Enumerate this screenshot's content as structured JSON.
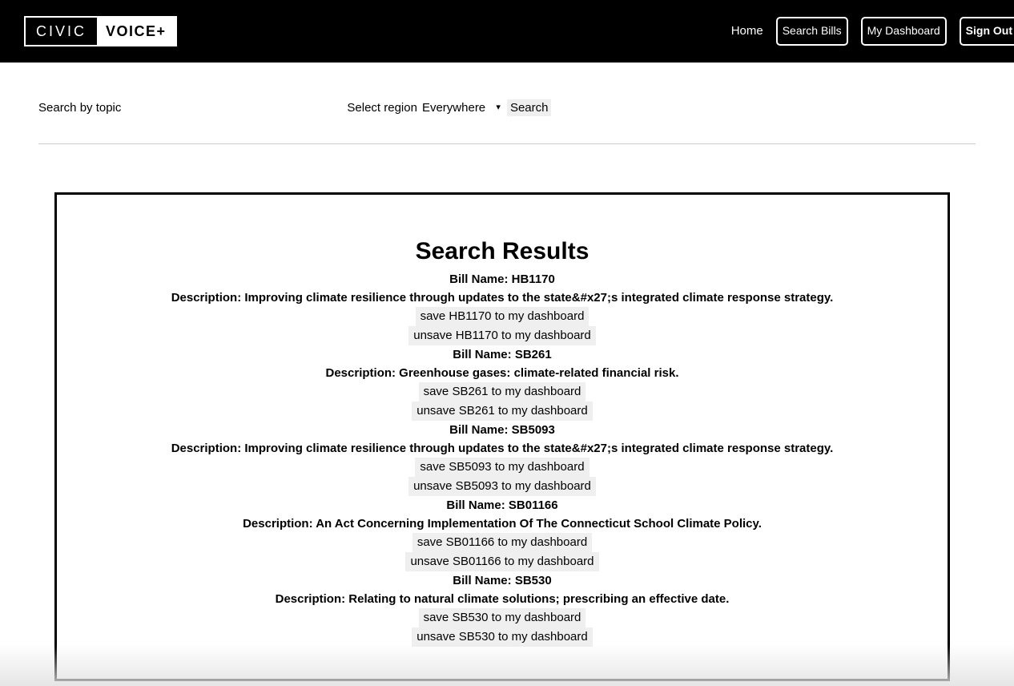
{
  "header": {
    "logo": {
      "left_text": "CIVIC",
      "right_text": "VOICE+"
    },
    "nav": {
      "home_label": "Home",
      "search_bills_label": "Search Bills",
      "my_dashboard_label": "My Dashboard",
      "sign_out_label": "Sign Out"
    },
    "background_color": "#000000",
    "text_color": "#ffffff"
  },
  "searchbar": {
    "topic_label": "Search by topic",
    "topic_value": "",
    "topic_placeholder": "",
    "region_label": "Select region",
    "region_selected": "Everywhere",
    "region_options": [
      "Everywhere"
    ],
    "dropdown_icon": "chevron-down-icon",
    "search_button_label": "Search",
    "button_background": "#efefef"
  },
  "results": {
    "title": "Search Results",
    "bills": [
      {
        "name": "Bill Name: HB1170",
        "description": "Description: Improving climate resilience through updates to the state&#x27;s integrated climate response strategy.",
        "save_label": "save HB1170 to my dashboard",
        "unsave_label": "unsave HB1170 to my dashboard"
      },
      {
        "name": "Bill Name: SB261",
        "description": "Description: Greenhouse gases: climate-related financial risk.",
        "save_label": "save SB261 to my dashboard",
        "unsave_label": "unsave SB261 to my dashboard"
      },
      {
        "name": "Bill Name: SB5093",
        "description": "Description: Improving climate resilience through updates to the state&#x27;s integrated climate response strategy.",
        "save_label": "save SB5093 to my dashboard",
        "unsave_label": "unsave SB5093 to my dashboard"
      },
      {
        "name": "Bill Name: SB01166",
        "description": "Description: An Act Concerning Implementation Of The Connecticut School Climate Policy.",
        "save_label": "save SB01166 to my dashboard",
        "unsave_label": "unsave SB01166 to my dashboard"
      },
      {
        "name": "Bill Name: SB530",
        "description": "Description: Relating to natural climate solutions; prescribing an effective date.",
        "save_label": "save SB530 to my dashboard",
        "unsave_label": "unsave SB530 to my dashboard"
      }
    ]
  }
}
